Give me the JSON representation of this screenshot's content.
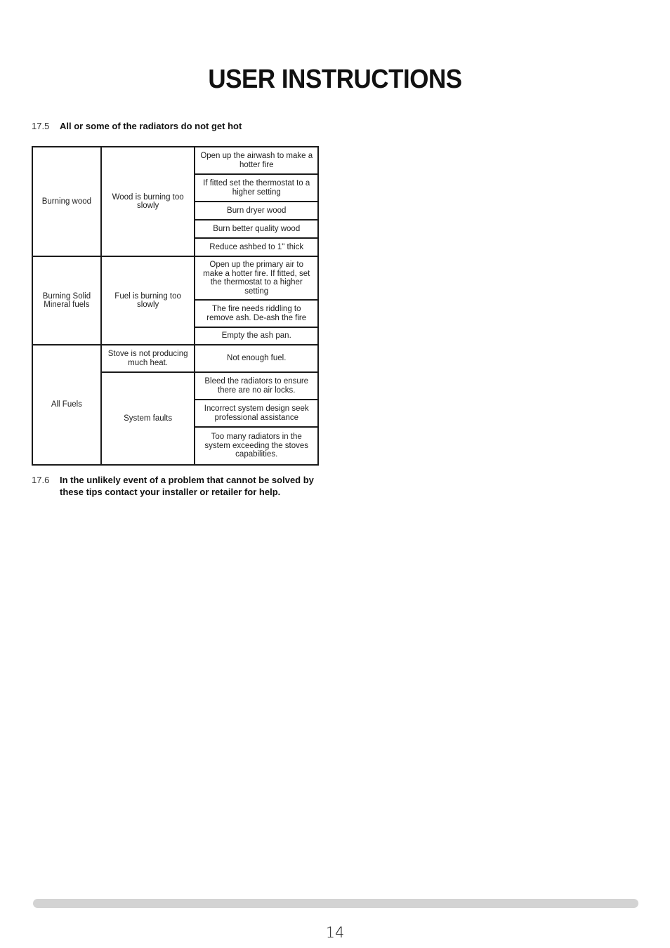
{
  "page": {
    "title": "USER INSTRUCTIONS",
    "page_number": "14"
  },
  "section_17_5": {
    "number": "17.5",
    "heading": "All or some of the radiators do not get hot"
  },
  "table": {
    "groups": [
      {
        "fuel": "Burning wood",
        "problems": [
          {
            "problem": "Wood is burning too slowly",
            "remedies": [
              "Open up the airwash to make a hotter fire",
              "If fitted set the thermostat to a higher setting",
              "Burn dryer wood",
              "Burn better quality wood",
              "Reduce ashbed to 1\" thick"
            ]
          }
        ]
      },
      {
        "fuel": "Burning Solid Mineral fuels",
        "problems": [
          {
            "problem": "Fuel is burning too slowly",
            "remedies": [
              "Open up the primary air to make a hotter fire. If fitted, set the thermostat to a higher setting",
              "The fire needs riddling to remove ash. De-ash the fire",
              "Empty the ash pan."
            ]
          }
        ]
      },
      {
        "fuel": "All Fuels",
        "problems": [
          {
            "problem": "Stove is not producing much heat.",
            "remedies": [
              "Not enough fuel."
            ]
          },
          {
            "problem": "System faults",
            "remedies": [
              "Bleed the radiators to ensure there are no air locks.",
              "Incorrect system design seek professional assistance",
              "Too many radiators in the system exceeding the stoves capabilities."
            ]
          }
        ]
      }
    ]
  },
  "section_17_6": {
    "number": "17.6",
    "text": "In the unlikely event of a problem that cannot be solved by these tips contact your installer or retailer for help."
  }
}
